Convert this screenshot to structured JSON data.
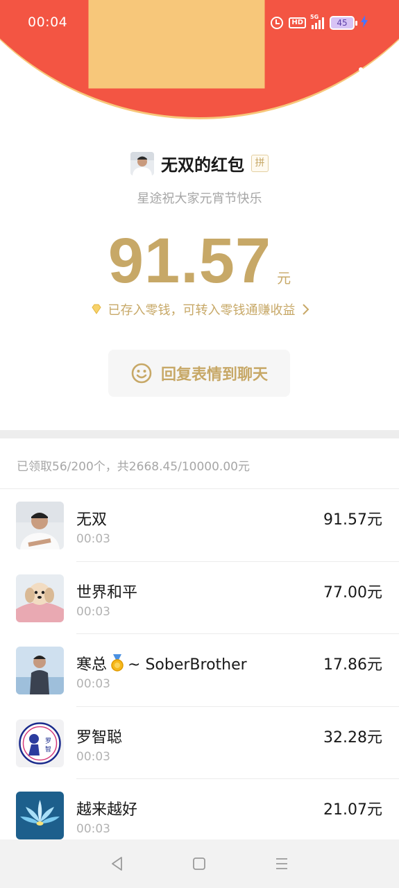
{
  "status_bar": {
    "time": "00:04",
    "hd": "HD",
    "network": "5G",
    "battery": "45"
  },
  "header": {
    "accent_color": "#f35543",
    "gold_color": "#c7a867",
    "back_icon": "chevron-left-icon",
    "more_icon": "more-dots-icon"
  },
  "sender": {
    "name": "无双的红包",
    "pin_badge": "拼",
    "blessing": "星途祝大家元宵节快乐"
  },
  "amount": {
    "value": "91.57",
    "unit": "元",
    "note": "已存入零钱，可转入零钱通赚收益"
  },
  "reply_button": {
    "label": "回复表情到聊天",
    "icon": "smile-icon"
  },
  "summary": "已领取56/200个，共2668.45/10000.00元",
  "records": [
    {
      "name": "无双",
      "time": "00:03",
      "amount": "91.57元",
      "avatar": "avatar-man-white-shirt"
    },
    {
      "name": "世界和平",
      "time": "00:03",
      "amount": "77.00元",
      "avatar": "avatar-dog"
    },
    {
      "name_prefix": "寒总",
      "name_suffix": "~ SoberBrother",
      "time": "00:03",
      "amount": "17.86元",
      "avatar": "avatar-man-seaside",
      "badge": "medal-icon"
    },
    {
      "name": "罗智聪",
      "time": "00:03",
      "amount": "32.28元",
      "avatar": "avatar-cartoon-logo",
      "logo_text": "罗智聪"
    },
    {
      "name": "越来越好",
      "time": "00:03",
      "amount": "21.07元",
      "avatar": "avatar-lotus"
    }
  ],
  "nav_bar": [
    "back-triangle-icon",
    "home-square-icon",
    "menu-lines-icon"
  ]
}
